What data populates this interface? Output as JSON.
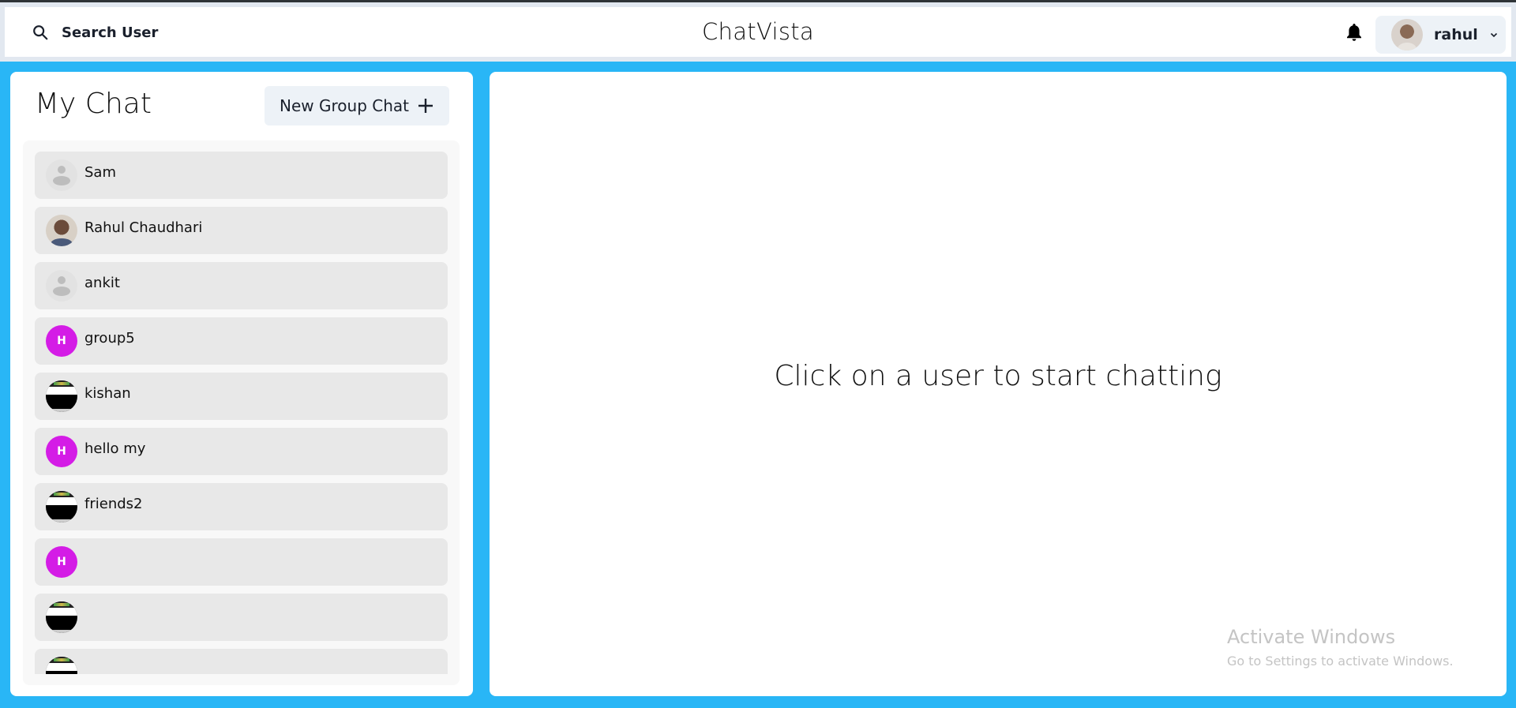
{
  "header": {
    "search_label": "Search User",
    "search_icon": "search-icon",
    "brand": "ChatVista",
    "notification_icon": "bell-icon",
    "profile": {
      "name": "rahul",
      "avatar": "user-photo",
      "menu_icon": "chevron-down-icon"
    }
  },
  "sidebar": {
    "title": "My Chat",
    "new_group_label": "New Group Chat",
    "new_group_icon": "plus-icon",
    "chats": [
      {
        "name": "Sam",
        "avatar_type": "default"
      },
      {
        "name": "Rahul Chaudhari",
        "avatar_type": "photo"
      },
      {
        "name": "ankit",
        "avatar_type": "default"
      },
      {
        "name": "group5",
        "avatar_type": "letter",
        "letter": "H"
      },
      {
        "name": "kishan",
        "avatar_type": "image-dark"
      },
      {
        "name": "hello my",
        "avatar_type": "letter",
        "letter": "H"
      },
      {
        "name": "friends2",
        "avatar_type": "image-dark"
      },
      {
        "name": "",
        "avatar_type": "letter",
        "letter": "H"
      },
      {
        "name": "",
        "avatar_type": "image-dark"
      },
      {
        "name": "",
        "avatar_type": "image-dark"
      }
    ]
  },
  "main": {
    "empty_message": "Click on a user to start chatting"
  },
  "watermark": {
    "title": "Activate Windows",
    "subtitle": "Go to Settings to activate Windows."
  },
  "colors": {
    "background": "#29b6f6",
    "group_avatar": "#d41ce6",
    "chat_item": "#e8e8e8",
    "button_bg": "#edf2f7"
  }
}
